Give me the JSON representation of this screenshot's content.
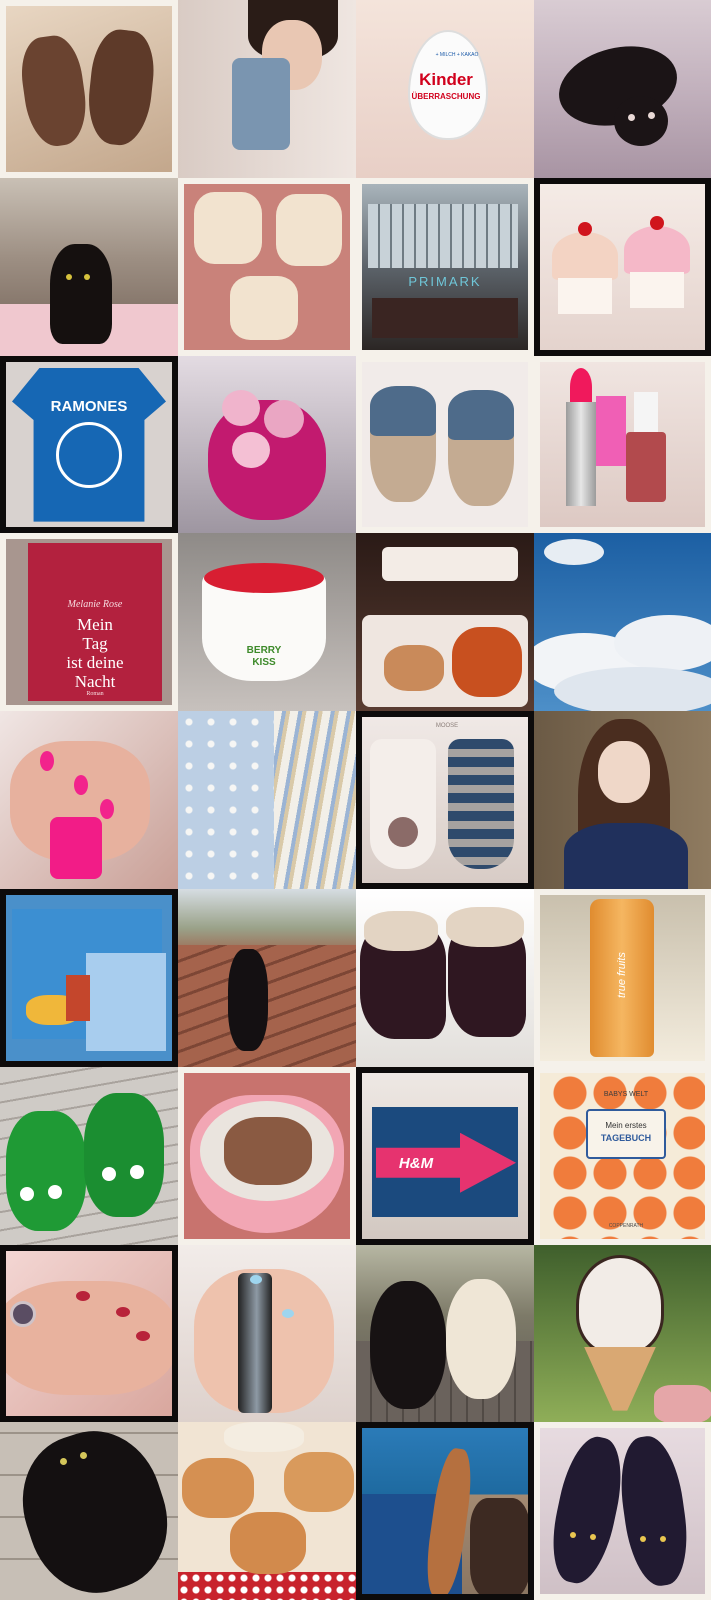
{
  "collage": {
    "photos": [
      {
        "subject": "brown baby shoes",
        "bg": "#cfb79f",
        "frame": "white"
      },
      {
        "subject": "girl selfie with phone",
        "bg": "#e8ddd7",
        "frame": "none"
      },
      {
        "subject": "kinder egg in hand",
        "bg": "#f2e2d9",
        "frame": "none"
      },
      {
        "subject": "black cat lying",
        "bg": "#b9a9b7",
        "frame": "none"
      },
      {
        "subject": "black cat in room",
        "bg": "#8d7f73",
        "frame": "none"
      },
      {
        "subject": "hello kitty cookies",
        "bg": "#d1948a",
        "frame": "white"
      },
      {
        "subject": "primark store front",
        "bg": "#6b6a69",
        "frame": "white"
      },
      {
        "subject": "cupcake salt shakers",
        "bg": "#efe3dd",
        "frame": "black"
      },
      {
        "subject": "blue ramones shirt",
        "bg": "#ddd6d2",
        "frame": "black"
      },
      {
        "subject": "pink rose bouquet",
        "bg": "#b8b0ba",
        "frame": "none"
      },
      {
        "subject": "crochet baby booties",
        "bg": "#efe8e6",
        "frame": "white"
      },
      {
        "subject": "lipstick and nail polish",
        "bg": "#e9dad3",
        "frame": "white"
      },
      {
        "subject": "mein tag ist deine nacht book",
        "bg": "#b6a7a0",
        "frame": "white"
      },
      {
        "subject": "frozen yogurt cup",
        "bg": "#9f9a97",
        "frame": "none"
      },
      {
        "subject": "chicken and curly fries",
        "bg": "#3d2a24",
        "frame": "none"
      },
      {
        "subject": "blue sky clouds",
        "bg": "#2a74b6",
        "frame": "none"
      },
      {
        "subject": "pink nail polish hand",
        "bg": "#d8b9b1",
        "frame": "none"
      },
      {
        "subject": "baby fabric sheep stripes",
        "bg": "#c9d5e3",
        "frame": "none"
      },
      {
        "subject": "baby socks moose",
        "bg": "#e4dad5",
        "frame": "black"
      },
      {
        "subject": "long hair girl portrait",
        "bg": "#7a6a55",
        "frame": "none"
      },
      {
        "subject": "blue dino baby clothes",
        "bg": "#5d9ed3",
        "frame": "black"
      },
      {
        "subject": "cat on roof",
        "bg": "#9a5c47",
        "frame": "none"
      },
      {
        "subject": "fur baby boots",
        "bg": "#eceae6",
        "frame": "none"
      },
      {
        "subject": "true fruits smoothie",
        "bg": "#e8dcc4",
        "frame": "white"
      },
      {
        "subject": "green crocodile slippers",
        "bg": "#c7c2bc",
        "frame": "none"
      },
      {
        "subject": "cereal bowl",
        "bg": "#cf8f8a",
        "frame": "white"
      },
      {
        "subject": "hm shopping box",
        "bg": "#e2dad5",
        "frame": "black"
      },
      {
        "subject": "baby diary book",
        "bg": "#f0e2cd",
        "frame": "white"
      },
      {
        "subject": "red nails and ring",
        "bg": "#e4c3bd",
        "frame": "black"
      },
      {
        "subject": "blue nail polish",
        "bg": "#ece4e0",
        "frame": "none"
      },
      {
        "subject": "two dogs on deck",
        "bg": "#8b7f6d",
        "frame": "none"
      },
      {
        "subject": "ice cream cone",
        "bg": "#6f8a44",
        "frame": "none"
      },
      {
        "subject": "black cat on tiles",
        "bg": "#cfc7bd",
        "frame": "none"
      },
      {
        "subject": "hello kitty fritters",
        "bg": "#e8d3bd",
        "frame": "none"
      },
      {
        "subject": "legs by pool",
        "bg": "#1e6aa0",
        "frame": "black"
      },
      {
        "subject": "cat face flats",
        "bg": "#ddd0d6",
        "frame": "white"
      }
    ]
  },
  "texts": {
    "kinder_brand": "Kinder",
    "kinder_sub": "ÜBERRASCHUNG",
    "kinder_badge": "+ MILCH + KAKAO",
    "primark": "PRIMARK",
    "ramones": "RAMONES",
    "book_author": "Melanie Rose",
    "book_title_1": "Mein",
    "book_title_2": "Tag",
    "book_title_3": "ist deine",
    "book_title_4": "Nacht",
    "book_footer": "Roman",
    "yogurt_brand_1": "BERRY",
    "yogurt_brand_2": "KISS",
    "socks_tag": "MOOSE",
    "smoothie_brand": "true fruits",
    "hm_logo": "H&M",
    "diary_brand": "BABYS WELT",
    "diary_title_1": "Mein erstes",
    "diary_title_2": "TAGEBUCH",
    "diary_publisher": "COPPENRATH"
  }
}
